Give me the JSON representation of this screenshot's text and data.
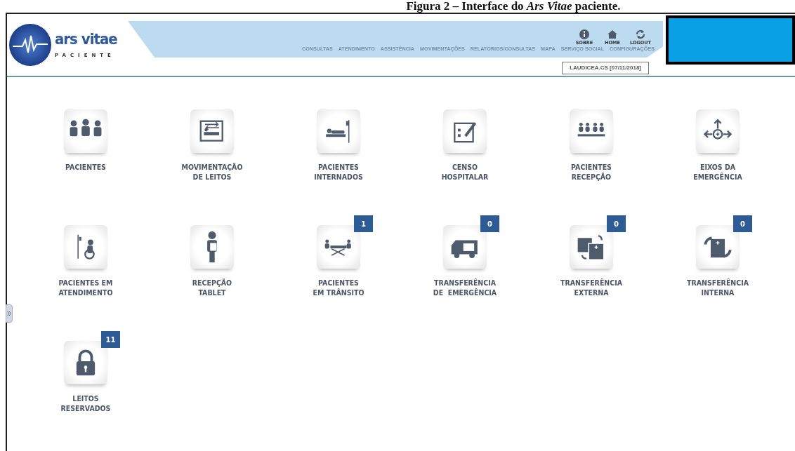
{
  "caption": "Figura 2 – Interface do *Ars Vitae* paciente.",
  "logo": {
    "name": "ars vitae",
    "subtitle": "PACIENTE"
  },
  "top_icons": [
    {
      "label": "SOBRE"
    },
    {
      "label": "HOME"
    },
    {
      "label": "LOGOUT"
    }
  ],
  "menu": [
    "CONSULTAS",
    "ATENDIMENTO",
    "ASSISTÊNCIA",
    "MOVIMENTAÇÕES",
    "RELATÓRIOS/CONSULTAS",
    "MAPA",
    "SERVIÇO SOCIAL",
    "CONFIGURAÇÕES"
  ],
  "user": "LAUDICEA.CS [07/11/2018]",
  "tiles": [
    {
      "lines": [
        "PACIENTES"
      ]
    },
    {
      "lines": [
        "MOVIMENTAÇÃO",
        "DE LEITOS"
      ]
    },
    {
      "lines": [
        "PACIENTES",
        "INTERNADOS"
      ]
    },
    {
      "lines": [
        "CENSO",
        "HOSPITALAR"
      ]
    },
    {
      "lines": [
        "PACIENTES",
        "RECEPÇÃO"
      ]
    },
    {
      "lines": [
        "EIXOS DA",
        "EMERGÊNCIA"
      ]
    },
    {
      "lines": [
        "PACIENTES EM",
        "ATENDIMENTO"
      ]
    },
    {
      "lines": [
        "RECEPÇÃO",
        "TABLET"
      ]
    },
    {
      "lines": [
        "PACIENTES",
        "EM TRÂNSITO"
      ],
      "badge": "1"
    },
    {
      "lines": [
        "TRANSFERÊNCIA",
        "DE  EMERGÊNCIA"
      ],
      "badge": "0"
    },
    {
      "lines": [
        "TRANSFERÊNCIA",
        "EXTERNA"
      ],
      "badge": "0"
    },
    {
      "lines": [
        "TRANSFERÊNCIA",
        "INTERNA"
      ],
      "badge": "0"
    },
    {
      "lines": [
        "LEITOS",
        "RESERVADOS"
      ],
      "badge": "11"
    }
  ]
}
